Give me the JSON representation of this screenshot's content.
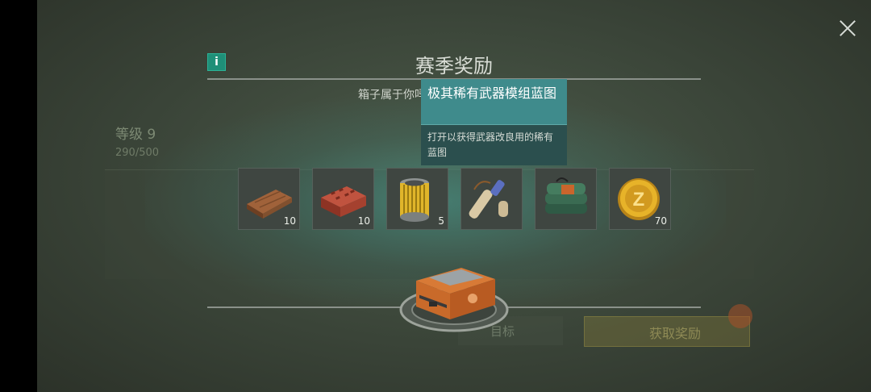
{
  "popup": {
    "title": "赛季奖励",
    "subtitle": "箱子属于你吗",
    "close_icon": "close-icon",
    "info_icon_label": "i"
  },
  "tooltip": {
    "title": "极其稀有武器模组蓝图",
    "description": "打开以获得武器改良用的稀有蓝图"
  },
  "items": [
    {
      "name": "wood-plank",
      "count": "10"
    },
    {
      "name": "brick",
      "count": "10"
    },
    {
      "name": "air-filter",
      "count": "5"
    },
    {
      "name": "blueprint-scroll",
      "count": ""
    },
    {
      "name": "explosive-bundle",
      "count": ""
    },
    {
      "name": "gold-coin",
      "count": "70"
    }
  ],
  "background": {
    "level": "等级 9",
    "xp": "290/500",
    "button_right": "获取奖励",
    "button_left": "目标"
  },
  "colors": {
    "accent": "#3f8b8c",
    "info": "#1f8f78"
  }
}
